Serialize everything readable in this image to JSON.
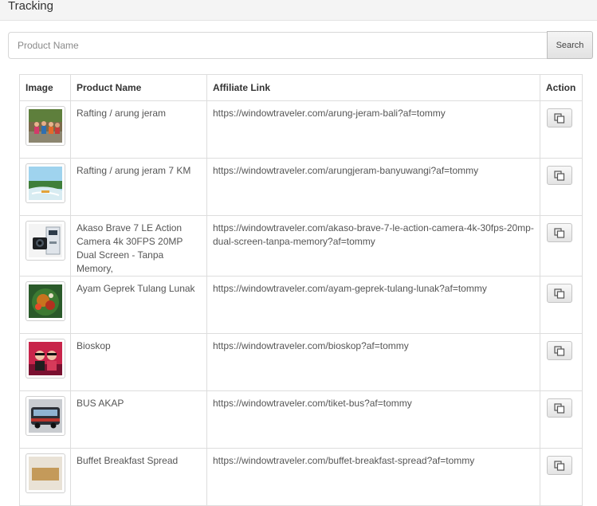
{
  "header": {
    "title": "Tracking"
  },
  "search": {
    "placeholder": "Product Name",
    "value": "",
    "button_label": "Search"
  },
  "table": {
    "columns": [
      "Image",
      "Product Name",
      "Affiliate Link",
      "Action"
    ],
    "rows": [
      {
        "name": "Rafting / arung jeram",
        "link": "https://windowtraveler.com/arung-jeram-bali?af=tommy",
        "thumb": "rafting"
      },
      {
        "name": "Rafting / arung jeram 7 KM",
        "link": "https://windowtraveler.com/arungjeram-banyuwangi?af=tommy",
        "thumb": "river"
      },
      {
        "name": "Akaso Brave 7 LE Action Camera 4k 30FPS 20MP Dual Screen - Tanpa Memory,",
        "link": "https://windowtraveler.com/akaso-brave-7-le-action-camera-4k-30fps-20mp-dual-screen-tanpa-memory?af=tommy",
        "thumb": "camera"
      },
      {
        "name": "Ayam Geprek Tulang Lunak",
        "link": "https://windowtraveler.com/ayam-geprek-tulang-lunak?af=tommy",
        "thumb": "food"
      },
      {
        "name": "Bioskop",
        "link": "https://windowtraveler.com/bioskop?af=tommy",
        "thumb": "cinema"
      },
      {
        "name": "BUS AKAP",
        "link": "https://windowtraveler.com/tiket-bus?af=tommy",
        "thumb": "bus"
      },
      {
        "name": "Buffet Breakfast Spread",
        "link": "https://windowtraveler.com/buffet-breakfast-spread?af=tommy",
        "thumb": "buffet"
      }
    ]
  },
  "icons": {
    "copy": "copy-icon"
  }
}
